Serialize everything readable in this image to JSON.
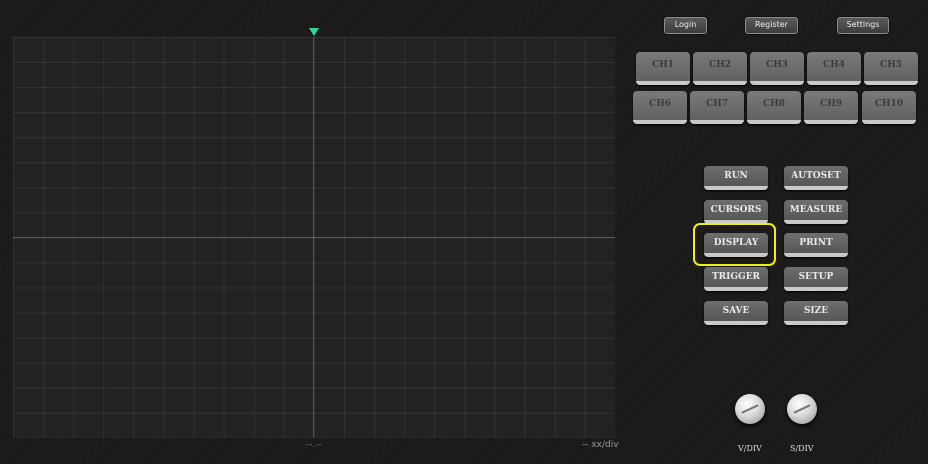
{
  "header": {
    "login_label": "Login",
    "register_label": "Register",
    "settings_label": "Settings"
  },
  "channels": [
    "CH1",
    "CH2",
    "CH3",
    "CH4",
    "CH5",
    "CH6",
    "CH7",
    "CH8",
    "CH9",
    "CH10"
  ],
  "controls": {
    "run": "RUN",
    "autoset": "AUTOSET",
    "cursors": "CURSORS",
    "measure": "MEASURE",
    "display": "DISPLAY",
    "print": "PRINT",
    "trigger": "TRIGGER",
    "setup": "SETUP",
    "save": "SAVE",
    "size": "SIZE"
  },
  "screen": {
    "center_readout": "--.--",
    "scale_readout": "-- xx/div"
  },
  "knobs": {
    "vdiv_label": "V/DIV",
    "sdiv_label": "S/DIV"
  },
  "colors": {
    "background": "#1c1a19",
    "screen": "#222222",
    "trigger_marker": "#2fd89a",
    "highlight": "#f0f00f"
  }
}
